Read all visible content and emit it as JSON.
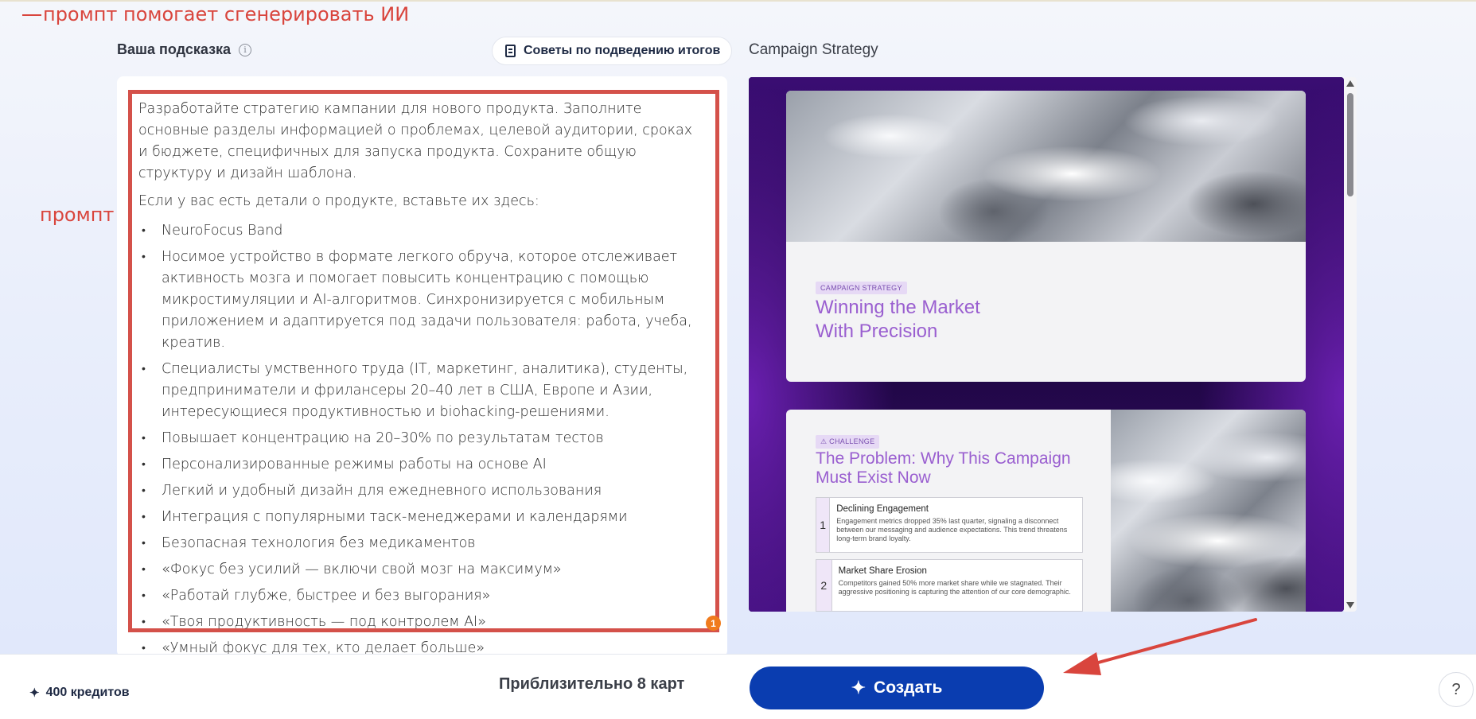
{
  "annotations": {
    "title": "промпт помогает сгенерировать ИИ",
    "side_label": "промпт",
    "accent_color": "#d9453d"
  },
  "prompt_panel": {
    "label": "Ваша подсказка",
    "info_icon": "i",
    "tips_button": "Советы по подведению итогов",
    "intro": "Разработайте стратегию кампании для нового продукта. Заполните основные разделы информацией о проблемах, целевой аудитории, сроках и бюджете, специфичных для запуска продукта. Сохраните общую структуру и дизайн шаблона.",
    "details_lead": "Если у вас есть детали о продукте, вставьте их здесь:",
    "items": [
      "NeuroFocus Band",
      "Носимое устройство в формате легкого обруча, которое отслеживает активность мозга и помогает повысить концентрацию с помощью микростимуляции и AI-алгоритмов. Синхронизируется с мобильным приложением и адаптируется под задачи пользователя: работа, учеба, креатив.",
      "Специалисты умственного труда (IT, маркетинг, аналитика), студенты, предприниматели и фрилансеры 20–40 лет в США, Европе и Азии, интересующиеся продуктивностью и biohacking-решениями.",
      "Повышает концентрацию на 20–30% по результатам тестов",
      "Персонализированные режимы работы на основе AI",
      "Легкий и удобный дизайн для ежедневного использования",
      "Интеграция с популярными таск-менеджерами и календарями",
      "Безопасная технология без медикаментов",
      "«Фокус без усилий — включи свой мозг на максимум»",
      "«Работай глубже, быстрее и без выгорания»",
      "«Твоя продуктивность — под контролем AI»",
      "«Умный фокус для тех, кто делает больше»"
    ],
    "badge_count": "1"
  },
  "preview": {
    "title": "Campaign Strategy",
    "slide1": {
      "tag": "CAMPAIGN STRATEGY",
      "title_line1": "Winning the Market",
      "title_line2": "With Precision"
    },
    "slide2": {
      "tag": "⚠ CHALLENGE",
      "title": "The Problem: Why This Campaign Must Exist Now",
      "issues": [
        {
          "num": "1",
          "title": "Declining Engagement",
          "text": "Engagement metrics dropped 35% last quarter, signaling a disconnect between our messaging and audience expectations. This trend threatens long-term brand loyalty."
        },
        {
          "num": "2",
          "title": "Market Share Erosion",
          "text": "Competitors gained 50% more market share while we stagnated. Their aggressive positioning is capturing the attention of our core demographic."
        }
      ]
    }
  },
  "footer": {
    "credits": "400 кредитов",
    "approx_cards": "Приблизительно 8 карт",
    "create_button": "Создать",
    "help": "?",
    "create_color": "#0a3db0"
  }
}
